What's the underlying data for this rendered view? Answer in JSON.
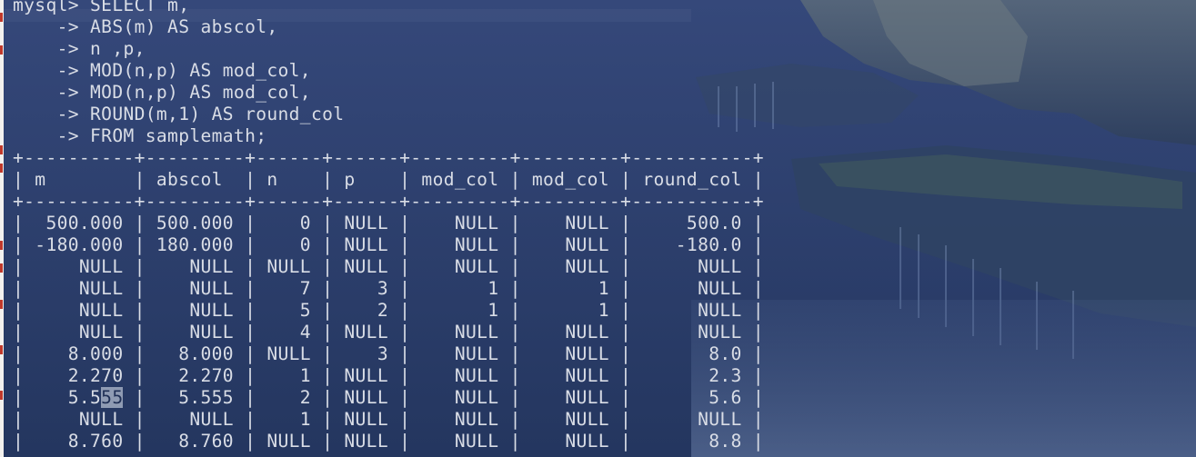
{
  "terminal": {
    "query_lines": [
      "mysql> SELECT m,",
      "    -> ABS(m) AS abscol,",
      "    -> n ,p,",
      "    -> MOD(n,p) AS mod_col,",
      "    -> MOD(n,p) AS mod_col,",
      "    -> ROUND(m,1) AS round_col",
      "    -> FROM samplemath;"
    ],
    "table": {
      "border": "+----------+---------+------+------+---------+---------+-----------+",
      "header": "| m        | abscol  | n    | p    | mod_col | mod_col | round_col |",
      "rows": [
        "|  500.000 | 500.000 |    0 | NULL |    NULL |    NULL |     500.0 |",
        "| -180.000 | 180.000 |    0 | NULL |    NULL |    NULL |    -180.0 |",
        "|     NULL |    NULL | NULL | NULL |    NULL |    NULL |      NULL |",
        "|     NULL |    NULL |    7 |    3 |       1 |       1 |      NULL |",
        "|     NULL |    NULL |    5 |    2 |       1 |       1 |      NULL |",
        "|     NULL |    NULL |    4 | NULL |    NULL |    NULL |      NULL |",
        "|    8.000 |   8.000 | NULL |    3 |    NULL |    NULL |       8.0 |",
        "|    2.270 |   2.270 |    1 | NULL |    NULL |    NULL |       2.3 |",
        "|    5.555 |   5.555 |    2 | NULL |    NULL |    NULL |       5.6 |",
        "|     NULL |    NULL |    1 | NULL |    NULL |    NULL |      NULL |",
        "|    8.760 |   8.760 | NULL | NULL |    NULL |    NULL |       8.8 |"
      ],
      "selected_row_index": 8,
      "selected_text": "55"
    }
  },
  "colors": {
    "text": "#d9dde6",
    "selection": "#8f9bb3",
    "background": "#22335a"
  }
}
